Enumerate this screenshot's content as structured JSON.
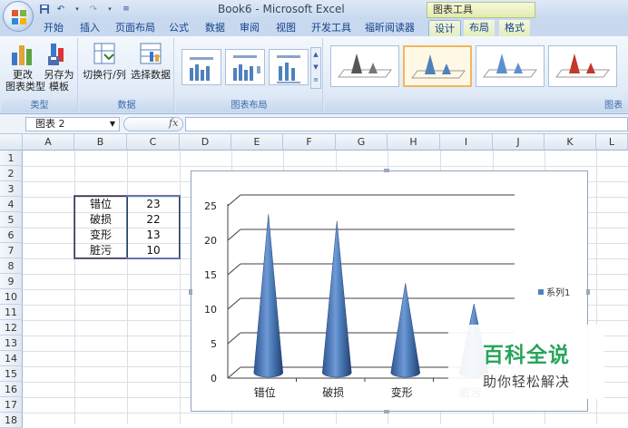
{
  "window": {
    "title": "Book6 - Microsoft Excel",
    "context_tools": "图表工具"
  },
  "tabs": [
    "开始",
    "插入",
    "页面布局",
    "公式",
    "数据",
    "审阅",
    "视图",
    "开发工具",
    "福昕阅读器",
    "设计",
    "布局",
    "格式"
  ],
  "active_tab": "设计",
  "ribbon": {
    "type_group": {
      "label": "类型",
      "change_type": "更改\n图表类型",
      "save_template": "另存为\n模板"
    },
    "data_group": {
      "label": "数据",
      "switch_row_col": "切换行/列",
      "select_data": "选择数据"
    },
    "layout_group": {
      "label": "图表布局"
    },
    "styles_group": {
      "label": "图表"
    }
  },
  "formula_bar": {
    "name_box": "图表 2",
    "fx": "fx",
    "value": ""
  },
  "grid": {
    "columns": [
      "A",
      "B",
      "C",
      "D",
      "E",
      "F",
      "G",
      "H",
      "I",
      "J",
      "K",
      "L"
    ],
    "rows": [
      "1",
      "2",
      "3",
      "4",
      "5",
      "6",
      "7",
      "8",
      "9",
      "10",
      "11",
      "12",
      "13",
      "14",
      "15",
      "16",
      "17",
      "18"
    ],
    "cells": [
      {
        "label": "错位",
        "value": "23"
      },
      {
        "label": "破损",
        "value": "22"
      },
      {
        "label": "变形",
        "value": "13"
      },
      {
        "label": "脏污",
        "value": "10"
      }
    ]
  },
  "chart_data": {
    "type": "bar",
    "subtype": "3d-cone",
    "categories": [
      "错位",
      "破损",
      "变形",
      "脏污"
    ],
    "series": [
      {
        "name": "系列1",
        "values": [
          23,
          22,
          13,
          10
        ]
      }
    ],
    "ylim": [
      0,
      25
    ],
    "yticks": [
      "0",
      "5",
      "10",
      "15",
      "20",
      "25"
    ],
    "grid": true,
    "legend_position": "right",
    "color": "#4f81bd"
  },
  "watermark": {
    "title": "百科全说",
    "subtitle": "助你轻松解决"
  }
}
